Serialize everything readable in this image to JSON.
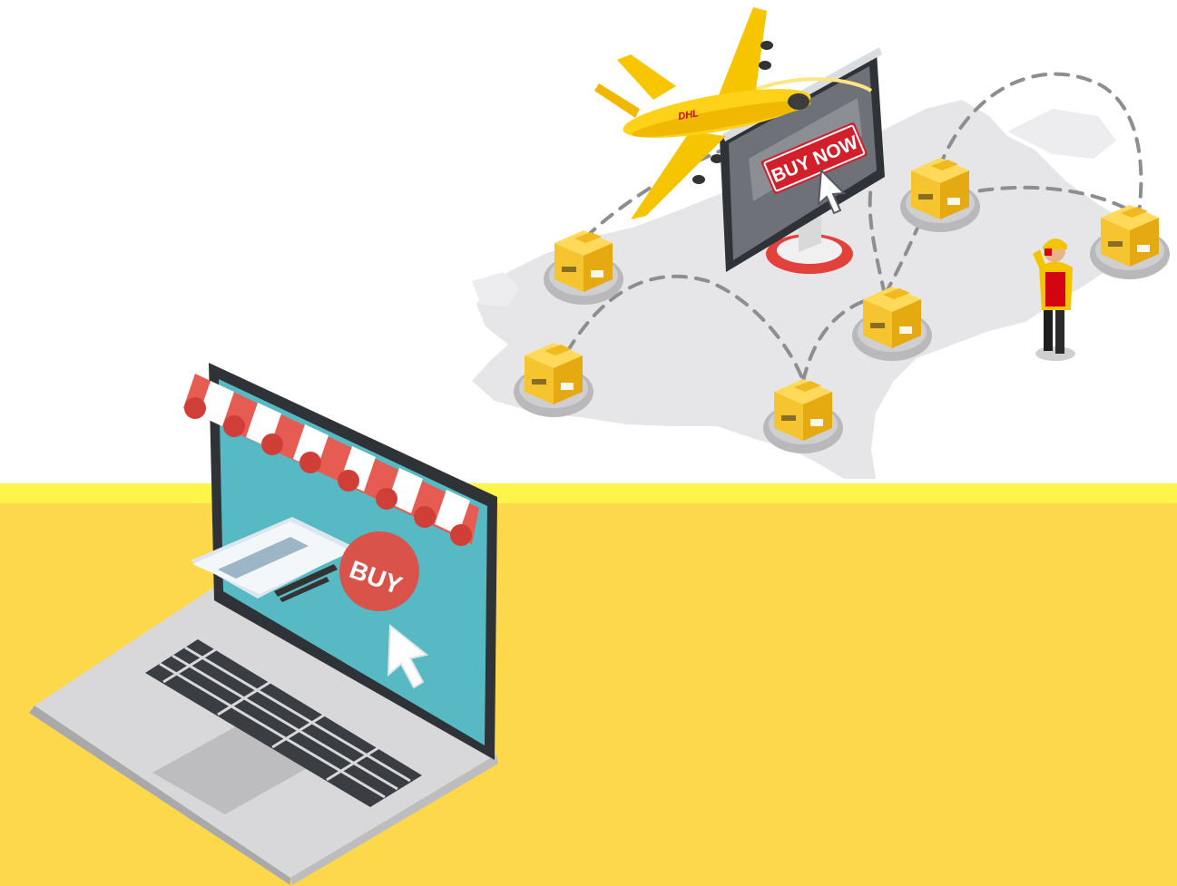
{
  "scene": {
    "laptop_button_label": "BUY",
    "monitor_button_label": "BUY NOW",
    "plane_logo": "DHL"
  },
  "colors": {
    "band_yellow": "#FDD84B",
    "band_highlight": "#FEF54A",
    "dhl_yellow": "#FFCC00",
    "dhl_red": "#D40511",
    "screen_teal": "#56B9C3",
    "buy_button_red": "#D9534A",
    "map_grey": "#E6E6E8",
    "box_yellow": "#F6C42F"
  }
}
